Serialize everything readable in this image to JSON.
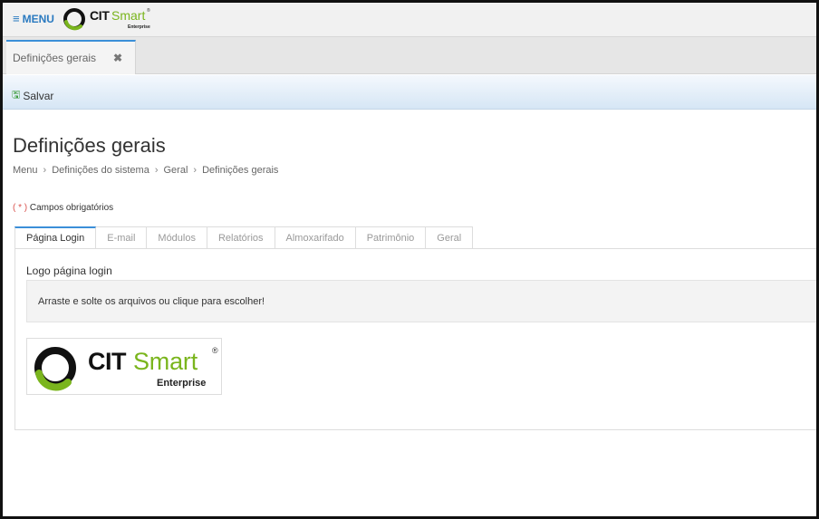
{
  "header": {
    "menu_icon": "≡",
    "menu_label": "MENU",
    "logo": {
      "cit": "CIT",
      "smart": "Smart",
      "sub": "Enterprise",
      "reg": "®"
    }
  },
  "doc_tab": {
    "label": "Definições gerais",
    "close": "✖"
  },
  "toolbar": {
    "save_icon": "🖫",
    "save_label": "Salvar"
  },
  "page": {
    "title": "Definições gerais",
    "breadcrumb": [
      "Menu",
      "Definições do sistema",
      "Geral",
      "Definições gerais"
    ],
    "breadcrumb_sep": "›",
    "required_mark": "( * )",
    "required_text": "Campos obrigatórios"
  },
  "tabs": [
    {
      "label": "Página Login",
      "active": true
    },
    {
      "label": "E-mail"
    },
    {
      "label": "Módulos"
    },
    {
      "label": "Relatórios"
    },
    {
      "label": "Almoxarifado"
    },
    {
      "label": "Patrimônio"
    },
    {
      "label": "Geral"
    }
  ],
  "panel": {
    "label": "Logo página login",
    "dropzone_text": "Arraste e solte os arquivos ou clique para escolher!"
  },
  "logo_preview": {
    "cit": "CIT",
    "smart": "Smart",
    "sub": "Enterprise",
    "reg": "®"
  },
  "colors": {
    "accent_blue": "#3b8fd8",
    "brand_green": "#7ab51d"
  }
}
